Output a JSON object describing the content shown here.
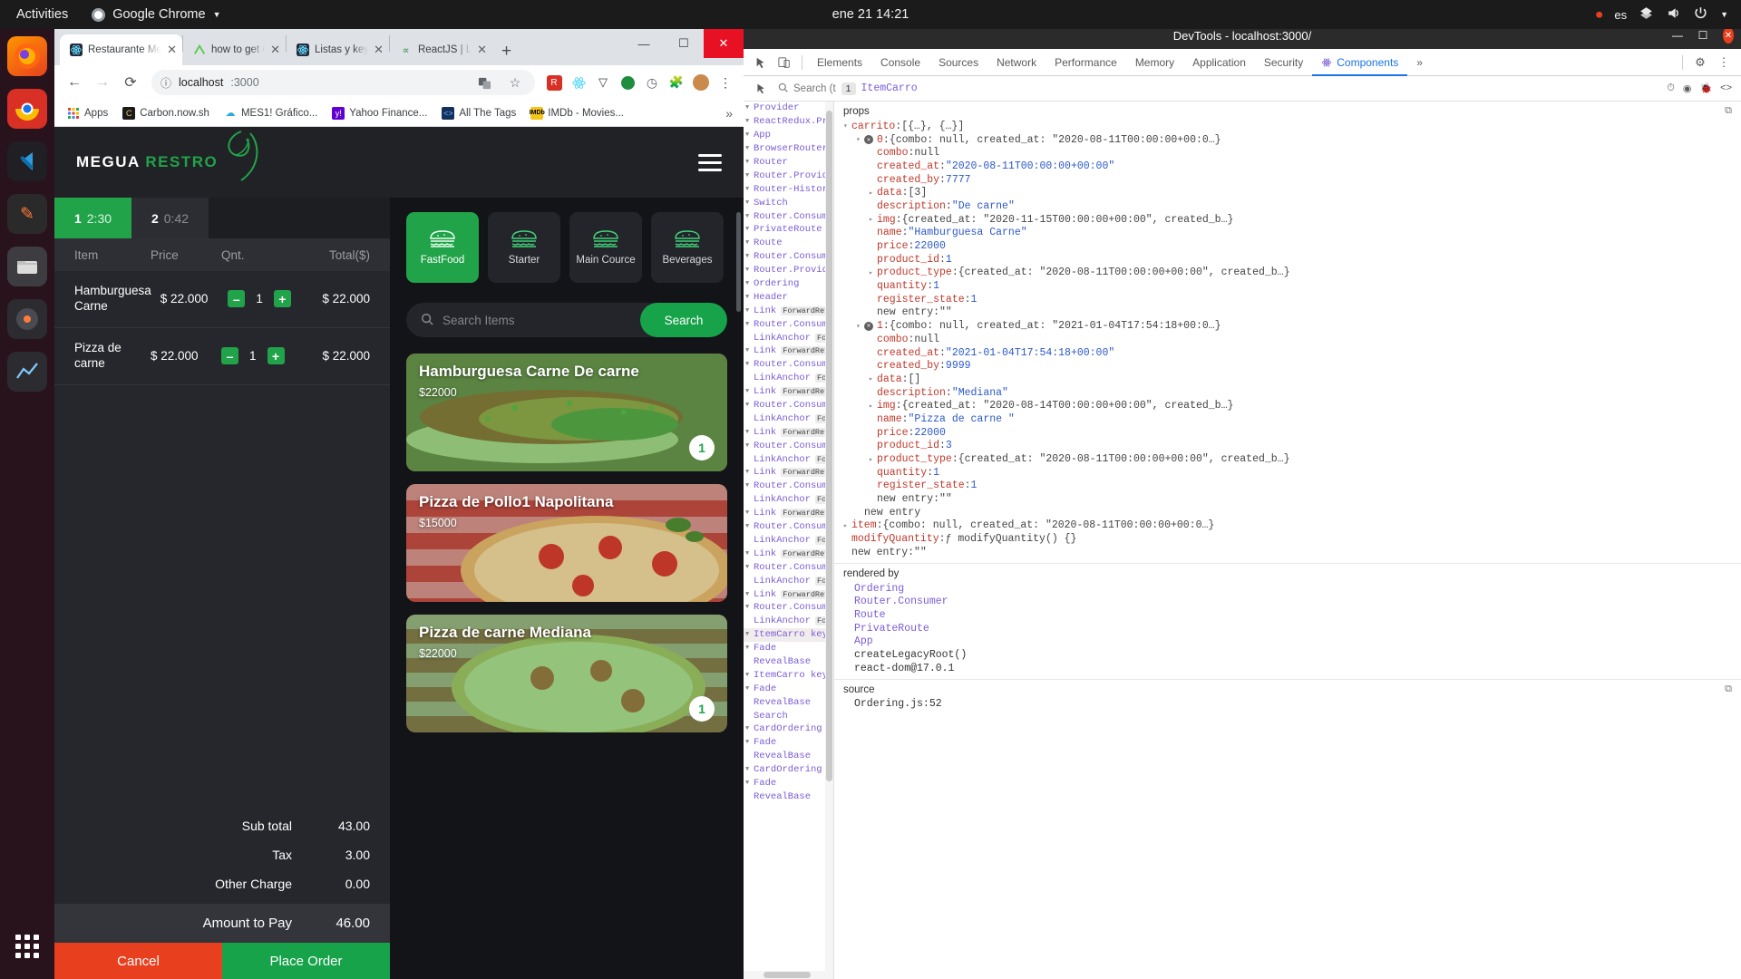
{
  "gnome": {
    "activities": "Activities",
    "app_menu": "Google Chrome",
    "clock": "ene 21  14:21",
    "keyboard": "es",
    "tray_icons": [
      "record-indicator-icon",
      "keyboard-layout-icon",
      "network-icon",
      "volume-icon",
      "power-icon",
      "chevron-down-icon"
    ]
  },
  "dock": {
    "items": [
      {
        "name": "firefox",
        "glyph": "🦊"
      },
      {
        "name": "google-chrome",
        "glyph": "◍"
      },
      {
        "name": "vs-code",
        "glyph": "‹›"
      },
      {
        "name": "gimp",
        "glyph": "✎"
      },
      {
        "name": "files",
        "glyph": "🗀"
      },
      {
        "name": "rhythmbox",
        "glyph": "◉"
      },
      {
        "name": "line-chart-app",
        "glyph": "📈"
      }
    ],
    "show_apps_label": "Show Applications"
  },
  "chrome": {
    "tabs": [
      {
        "title": "Restaurante Meg",
        "favicon": "react-icon",
        "active": true
      },
      {
        "title": "how to get elem",
        "favicon": "js-icon",
        "active": false
      },
      {
        "title": "Listas y keys – Re",
        "favicon": "react-icon",
        "active": false
      },
      {
        "title": "ReactJS | Lists - C",
        "favicon": "geeks-icon",
        "active": false
      }
    ],
    "new_tab_label": "+",
    "window_controls": {
      "minimize": "—",
      "maximize": "☐",
      "close": "✕"
    },
    "nav": {
      "back": "←",
      "forward": "→",
      "reload": "⟳"
    },
    "omnibox": {
      "security": "ⓘ",
      "host": "localhost",
      "path": ":3000",
      "value": "localhost:3000"
    },
    "toolbar_icons": [
      "translate-icon",
      "bookmark-star-icon",
      "extension-red-icon",
      "react-devtools-icon",
      "vimium-icon",
      "recorder-icon",
      "clock-icon",
      "puzzle-icon",
      "profile-avatar",
      "menu-kebab-icon"
    ],
    "bookmarks": [
      {
        "label": "Apps",
        "icon": "apps-grid-icon",
        "color": "#ffffff"
      },
      {
        "label": "Carbon.now.sh",
        "icon": "carbon-icon",
        "color": "#1a1a1a"
      },
      {
        "label": "MES1! Gráfico...",
        "icon": "cloud-icon",
        "color": "#29a9e0"
      },
      {
        "label": "Yahoo Finance...",
        "icon": "yahoo-icon",
        "color": "#6001d2"
      },
      {
        "label": "All The Tags",
        "icon": "code-icon",
        "color": "#13315c"
      },
      {
        "label": "IMDb - Movies...",
        "icon": "imdb-icon",
        "color": "#f5c518"
      }
    ],
    "bookmarks_overflow": "»"
  },
  "app": {
    "logo": {
      "first": "MEGUA",
      "second": "RESTRO",
      "mark": "leaf-icon"
    },
    "menu_icon": "hamburger-menu-icon",
    "order_tabs": [
      {
        "number": "1",
        "timer": "2:30",
        "active": true
      },
      {
        "number": "2",
        "timer": "0:42",
        "active": false
      }
    ],
    "cart": {
      "columns": [
        "Item",
        "Price",
        "Qnt.",
        "Total($)"
      ],
      "rows": [
        {
          "item": "Hamburguesa Carne",
          "price": "$ 22.000",
          "qty": "1",
          "total": "$ 22.000"
        },
        {
          "item": "Pizza de carne",
          "price": "$ 22.000",
          "qty": "1",
          "total": "$ 22.000"
        }
      ],
      "decrement_label": "–",
      "increment_label": "+",
      "totals": [
        {
          "label": "Sub total",
          "value": "43.00"
        },
        {
          "label": "Tax",
          "value": "3.00"
        },
        {
          "label": "Other Charge",
          "value": "0.00"
        }
      ],
      "amount_label": "Amount to Pay",
      "amount_value": "46.00",
      "cancel_label": "Cancel",
      "place_order_label": "Place Order"
    },
    "categories": [
      {
        "label": "FastFood",
        "icon": "burger-icon",
        "active": true
      },
      {
        "label": "Starter",
        "icon": "burger-icon",
        "active": false
      },
      {
        "label": "Main Cource",
        "icon": "burger-icon",
        "active": false
      },
      {
        "label": "Beverages",
        "icon": "burger-icon",
        "active": false
      }
    ],
    "search": {
      "placeholder": "Search Items",
      "value": "",
      "button_label": "Search",
      "icon": "search-icon"
    },
    "products": [
      {
        "title": "Hamburguesa Carne De carne",
        "price": "$22000",
        "badge": "1",
        "selected": true,
        "img": "sandwich-photo"
      },
      {
        "title": "Pizza de Pollo1 Napolitana",
        "price": "$15000",
        "badge": "",
        "selected": false,
        "img": "pizza-photo"
      },
      {
        "title": "Pizza de carne Mediana",
        "price": "$22000",
        "badge": "1",
        "selected": true,
        "img": "pizza-photo-2"
      }
    ],
    "accent_green": "#21a34a",
    "accent_red": "#e8401f"
  },
  "devtools": {
    "window_title": "DevTools - localhost:3000/",
    "window_controls": {
      "minimize": "—",
      "maximize": "☐",
      "close": "✕"
    },
    "toolbar_icons": [
      "inspect-element-icon",
      "device-toolbar-icon"
    ],
    "tabs": [
      "Elements",
      "Console",
      "Sources",
      "Network",
      "Performance",
      "Memory",
      "Application",
      "Security",
      "Components"
    ],
    "active_tab": "Components",
    "tabs_overflow": "»",
    "settings_icon": "gear-icon",
    "more_icon": "kebab-menu-icon",
    "search": {
      "icon": "search-icon",
      "placeholder": "Search (t",
      "match_count": "1",
      "selected_component": "ItemCarro",
      "right_icons": [
        "suspense-icon",
        "eye-icon",
        "bug-icon",
        "source-icon"
      ]
    },
    "tree": [
      {
        "label": "Provider",
        "arrow": true
      },
      {
        "label": "ReactRedux.Prov",
        "arrow": true
      },
      {
        "label": "App",
        "arrow": true
      },
      {
        "label": "BrowserRouter",
        "arrow": true
      },
      {
        "label": "Router",
        "arrow": true
      },
      {
        "label": "Router.Provider",
        "arrow": true
      },
      {
        "label": "Router-History.",
        "arrow": true
      },
      {
        "label": "Switch",
        "arrow": true
      },
      {
        "label": "Router.Consumer",
        "arrow": true
      },
      {
        "label": "PrivateRoute",
        "arrow": true
      },
      {
        "label": "Route",
        "arrow": true
      },
      {
        "label": "Router.Consumer",
        "arrow": true
      },
      {
        "label": "Router.Provider",
        "arrow": true
      },
      {
        "label": "Ordering",
        "arrow": true
      },
      {
        "label": "Header",
        "arrow": true
      },
      {
        "label": "Link",
        "arrow": true,
        "tag": "ForwardRef"
      },
      {
        "label": "Router.Consumer",
        "arrow": true
      },
      {
        "label": "LinkAnchor",
        "arrow": false,
        "tag": "Forw"
      },
      {
        "label": "Link",
        "arrow": true,
        "tag": "ForwardRef"
      },
      {
        "label": "Router.Consumer",
        "arrow": true
      },
      {
        "label": "LinkAnchor",
        "arrow": false,
        "tag": "Forw"
      },
      {
        "label": "Link",
        "arrow": true,
        "tag": "ForwardRef"
      },
      {
        "label": "Router.Consumer",
        "arrow": true
      },
      {
        "label": "LinkAnchor",
        "arrow": false,
        "tag": "Forw"
      },
      {
        "label": "Link",
        "arrow": true,
        "tag": "ForwardRef"
      },
      {
        "label": "Router.Consumer",
        "arrow": true
      },
      {
        "label": "LinkAnchor",
        "arrow": false,
        "tag": "Forw"
      },
      {
        "label": "Link",
        "arrow": true,
        "tag": "ForwardRef"
      },
      {
        "label": "Router.Consumer",
        "arrow": true
      },
      {
        "label": "LinkAnchor",
        "arrow": false,
        "tag": "Forw"
      },
      {
        "label": "Link",
        "arrow": true,
        "tag": "ForwardRef"
      },
      {
        "label": "Router.Consumer",
        "arrow": true
      },
      {
        "label": "LinkAnchor",
        "arrow": false,
        "tag": "Forw"
      },
      {
        "label": "Link",
        "arrow": true,
        "tag": "ForwardRef"
      },
      {
        "label": "Router.Consumer",
        "arrow": true
      },
      {
        "label": "LinkAnchor",
        "arrow": false,
        "tag": "Forw"
      },
      {
        "label": "Link",
        "arrow": true,
        "tag": "ForwardRef"
      },
      {
        "label": "Router.Consumer",
        "arrow": true
      },
      {
        "label": "LinkAnchor",
        "arrow": false,
        "tag": "Forw"
      },
      {
        "label": "ItemCarro key='",
        "arrow": true,
        "selected": true
      },
      {
        "label": "Fade",
        "arrow": true
      },
      {
        "label": "RevealBase",
        "arrow": false
      },
      {
        "label": "ItemCarro key='",
        "arrow": true
      },
      {
        "label": "Fade",
        "arrow": true
      },
      {
        "label": "RevealBase",
        "arrow": false
      },
      {
        "label": "Search",
        "arrow": false
      },
      {
        "label": "CardOrdering ke",
        "arrow": true
      },
      {
        "label": "Fade",
        "arrow": true
      },
      {
        "label": "RevealBase",
        "arrow": false
      },
      {
        "label": "CardOrdering ke",
        "arrow": true
      },
      {
        "label": "Fade",
        "arrow": true
      },
      {
        "label": "RevealBase",
        "arrow": false
      }
    ],
    "props_title": "props",
    "props_copy_icon": "copy-icon",
    "props_lines": [
      {
        "indent": 0,
        "arrow": "▾",
        "key": "carrito",
        "sep": ": ",
        "val": "[{…}, {…}]",
        "vtype": "plain"
      },
      {
        "indent": 1,
        "arrow": "▾",
        "badge": true,
        "key": "0",
        "sep": ": ",
        "val": "{combo: null, created_at: \"2020-08-11T00:00:00+00:0…}",
        "vtype": "plain"
      },
      {
        "indent": 2,
        "key": "combo",
        "sep": ": ",
        "val": "null",
        "vtype": "plain"
      },
      {
        "indent": 2,
        "key": "created_at",
        "sep": ": ",
        "val": "\"2020-08-11T00:00:00+00:00\"",
        "vtype": "s"
      },
      {
        "indent": 2,
        "key": "created_by",
        "sep": ": ",
        "val": "7777",
        "vtype": "n"
      },
      {
        "indent": 2,
        "arrow": "▸",
        "key": "data",
        "sep": ": ",
        "val": "[3]",
        "vtype": "plain"
      },
      {
        "indent": 2,
        "key": "description",
        "sep": ": ",
        "val": "\"De carne\"",
        "vtype": "s"
      },
      {
        "indent": 2,
        "arrow": "▸",
        "key": "img",
        "sep": ": ",
        "val": "{created_at: \"2020-11-15T00:00:00+00:00\", created_b…}",
        "vtype": "plain"
      },
      {
        "indent": 2,
        "key": "name",
        "sep": ": ",
        "val": "\"Hamburguesa Carne\"",
        "vtype": "s"
      },
      {
        "indent": 2,
        "key": "price",
        "sep": ": ",
        "val": "22000",
        "vtype": "n"
      },
      {
        "indent": 2,
        "key": "product_id",
        "sep": ": ",
        "val": "1",
        "vtype": "n"
      },
      {
        "indent": 2,
        "arrow": "▸",
        "key": "product_type",
        "sep": ": ",
        "val": "{created_at: \"2020-08-11T00:00:00+00:00\", created_b…}",
        "vtype": "plain"
      },
      {
        "indent": 2,
        "key": "quantity",
        "sep": ": ",
        "val": "1",
        "vtype": "n"
      },
      {
        "indent": 2,
        "key": "register_state",
        "sep": ": ",
        "val": "1",
        "vtype": "n"
      },
      {
        "indent": 2,
        "key": "new entry",
        "sep": ": ",
        "val": "\"\"",
        "vtype": "plain",
        "kplain": true
      },
      {
        "indent": 1,
        "arrow": "▾",
        "badge": true,
        "key": "1",
        "sep": ": ",
        "val": "{combo: null, created_at: \"2021-01-04T17:54:18+00:0…}",
        "vtype": "plain"
      },
      {
        "indent": 2,
        "key": "combo",
        "sep": ": ",
        "val": "null",
        "vtype": "plain"
      },
      {
        "indent": 2,
        "key": "created_at",
        "sep": ": ",
        "val": "\"2021-01-04T17:54:18+00:00\"",
        "vtype": "s"
      },
      {
        "indent": 2,
        "key": "created_by",
        "sep": ": ",
        "val": "9999",
        "vtype": "n"
      },
      {
        "indent": 2,
        "arrow": "▸",
        "key": "data",
        "sep": ": ",
        "val": "[]",
        "vtype": "plain"
      },
      {
        "indent": 2,
        "key": "description",
        "sep": ": ",
        "val": "\"Mediana\"",
        "vtype": "s"
      },
      {
        "indent": 2,
        "arrow": "▸",
        "key": "img",
        "sep": ": ",
        "val": "{created_at: \"2020-08-14T00:00:00+00:00\", created_b…}",
        "vtype": "plain"
      },
      {
        "indent": 2,
        "key": "name",
        "sep": ": ",
        "val": "\"Pizza de carne \"",
        "vtype": "s"
      },
      {
        "indent": 2,
        "key": "price",
        "sep": ": ",
        "val": "22000",
        "vtype": "n"
      },
      {
        "indent": 2,
        "key": "product_id",
        "sep": ": ",
        "val": "3",
        "vtype": "n"
      },
      {
        "indent": 2,
        "arrow": "▸",
        "key": "product_type",
        "sep": ": ",
        "val": "{created_at: \"2020-08-11T00:00:00+00:00\", created_b…}",
        "vtype": "plain"
      },
      {
        "indent": 2,
        "key": "quantity",
        "sep": ": ",
        "val": "1",
        "vtype": "n"
      },
      {
        "indent": 2,
        "key": "register_state",
        "sep": ": ",
        "val": "1",
        "vtype": "n"
      },
      {
        "indent": 2,
        "key": "new entry",
        "sep": ": ",
        "val": "\"\"",
        "vtype": "plain",
        "kplain": true
      },
      {
        "indent": 1,
        "key": "new entry",
        "sep": "",
        "val": "",
        "vtype": "plain",
        "kplain": true
      },
      {
        "indent": 0,
        "arrow": "▸",
        "key": "item",
        "sep": ": ",
        "val": "{combo: null, created_at: \"2020-08-11T00:00:00+00:0…}",
        "vtype": "plain"
      },
      {
        "indent": 0,
        "key": "modifyQuantity",
        "sep": ": ",
        "val": "ƒ modifyQuantity() {}",
        "vtype": "plain",
        "noarrow": true
      },
      {
        "indent": 0,
        "key": "new entry",
        "sep": ": ",
        "val": "\"\"",
        "vtype": "plain",
        "kplain": true,
        "noarrow": true
      }
    ],
    "rendered_by_title": "rendered by",
    "rendered_by": [
      {
        "label": "Ordering",
        "link": true
      },
      {
        "label": "Router.Consumer",
        "link": true
      },
      {
        "label": "Route",
        "link": true
      },
      {
        "label": "PrivateRoute",
        "link": true
      },
      {
        "label": "App",
        "link": true
      },
      {
        "label": "createLegacyRoot()",
        "link": false
      },
      {
        "label": "react-dom@17.0.1",
        "link": false
      }
    ],
    "source_title": "source",
    "source_copy_icon": "copy-icon",
    "source_value": "Ordering.js:52"
  }
}
